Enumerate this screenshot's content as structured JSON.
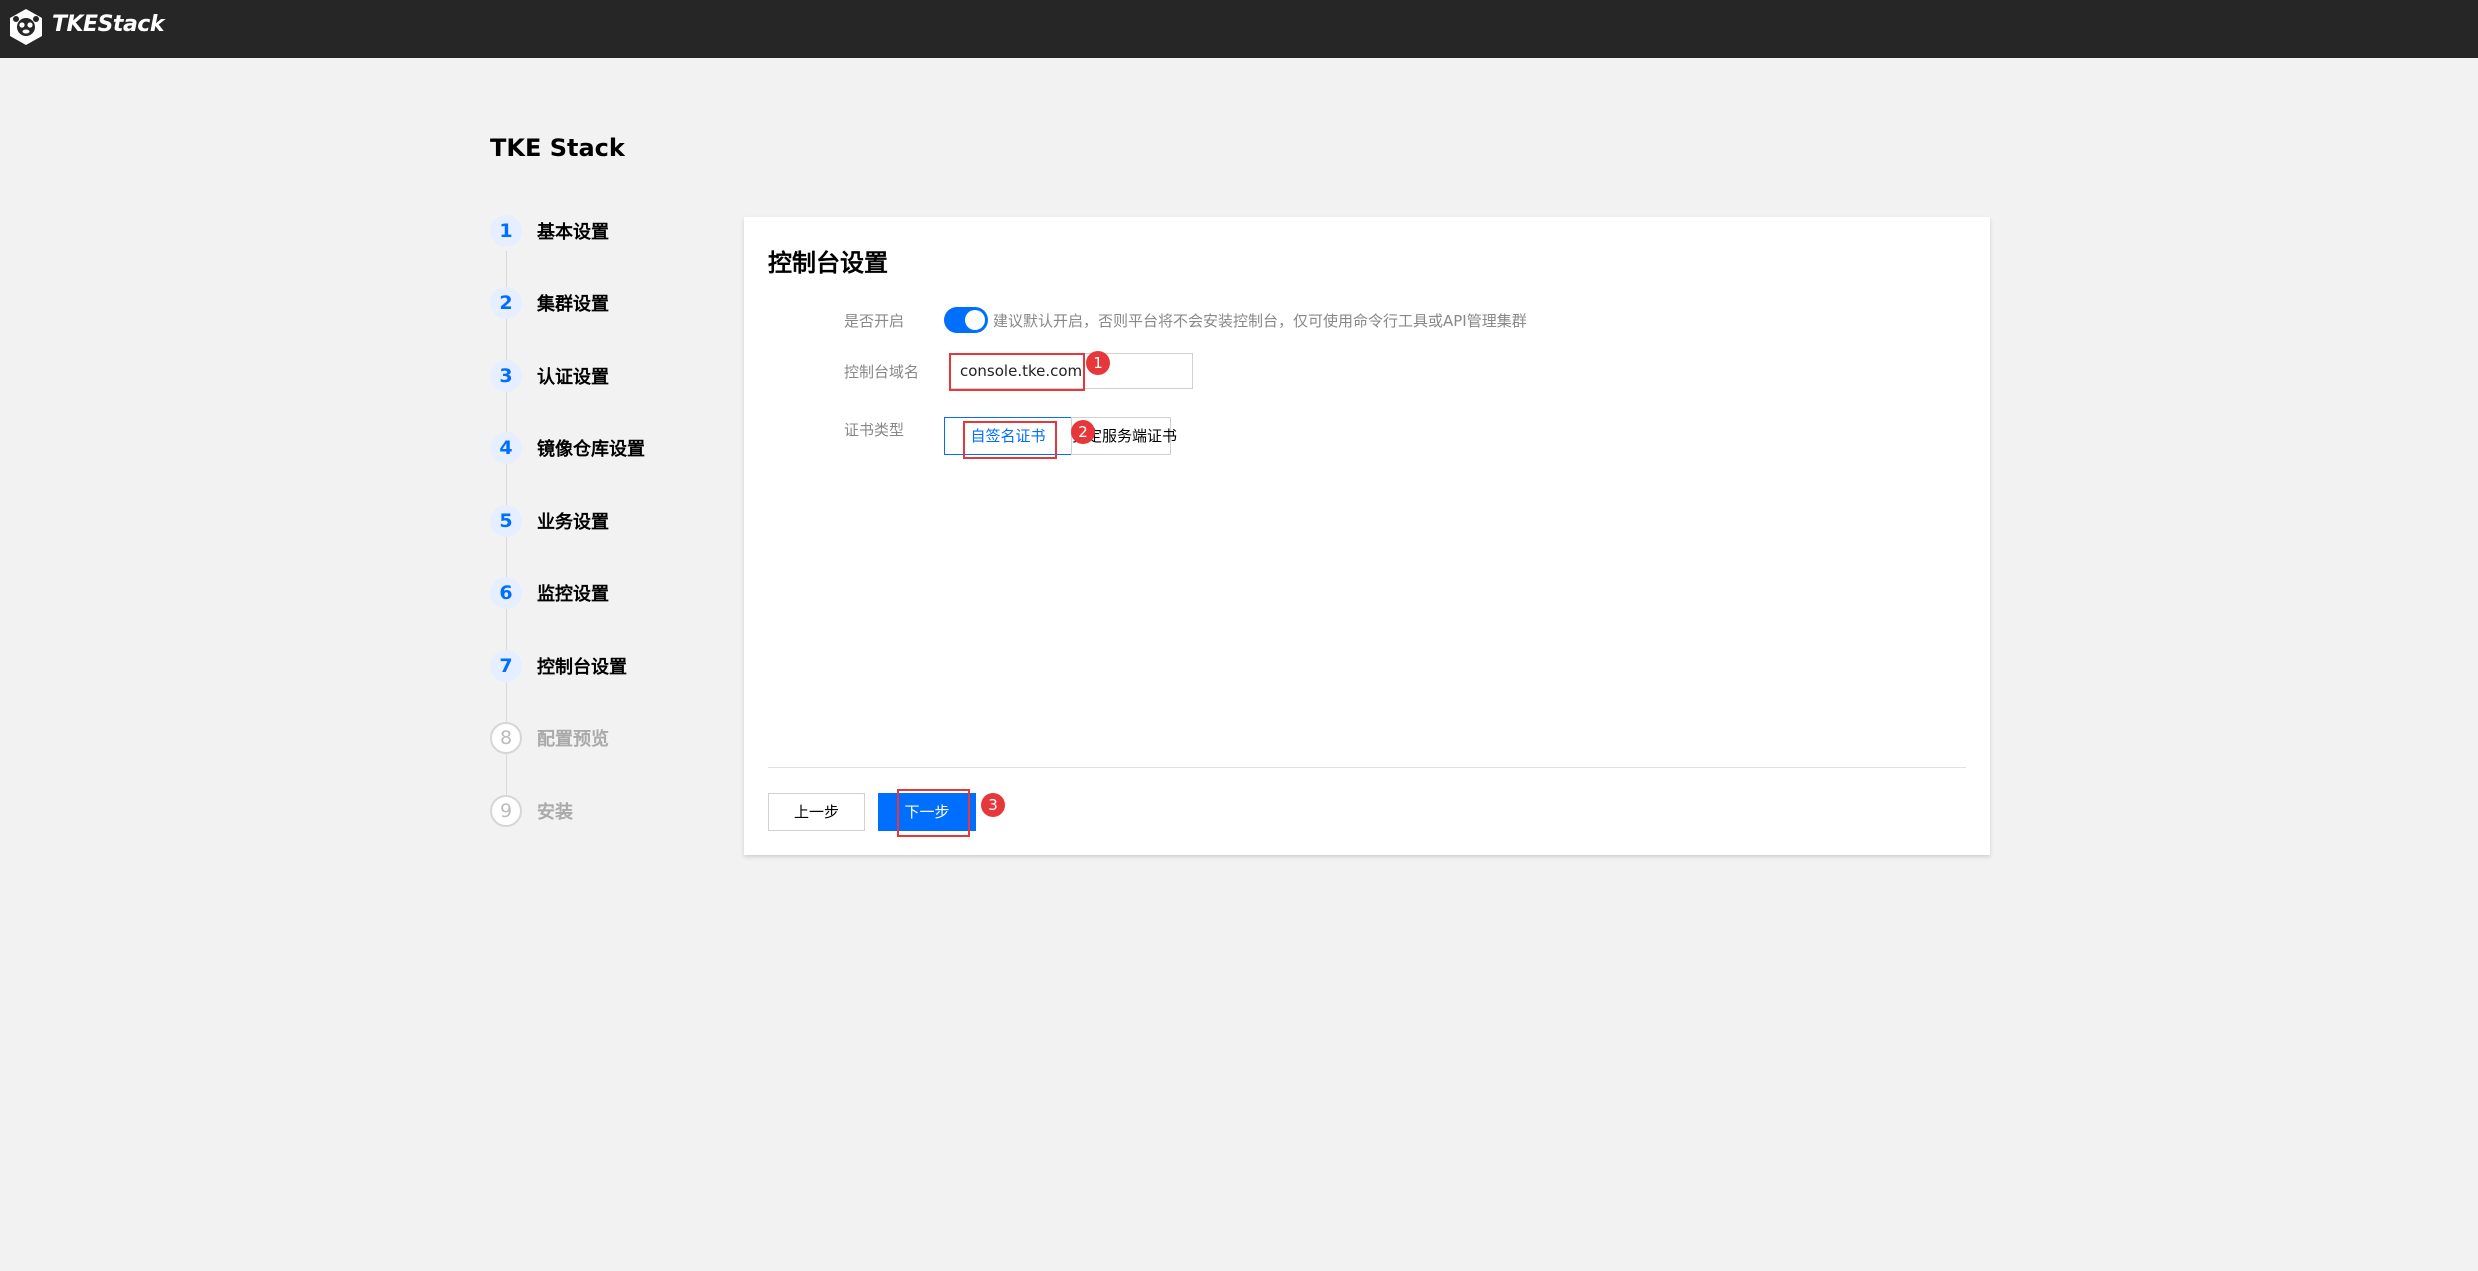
{
  "app": {
    "name": "TKEStack"
  },
  "page": {
    "title": "TKE Stack"
  },
  "steps": [
    {
      "num": "1",
      "label": "基本设置",
      "state": "done"
    },
    {
      "num": "2",
      "label": "集群设置",
      "state": "done"
    },
    {
      "num": "3",
      "label": "认证设置",
      "state": "done"
    },
    {
      "num": "4",
      "label": "镜像仓库设置",
      "state": "done"
    },
    {
      "num": "5",
      "label": "业务设置",
      "state": "done"
    },
    {
      "num": "6",
      "label": "监控设置",
      "state": "done"
    },
    {
      "num": "7",
      "label": "控制台设置",
      "state": "done"
    },
    {
      "num": "8",
      "label": "配置预览",
      "state": "todo"
    },
    {
      "num": "9",
      "label": "安装",
      "state": "todo"
    }
  ],
  "form": {
    "title": "控制台设置",
    "enable_label": "是否开启",
    "enable_hint": "建议默认开启，否则平台将不会安装控制台，仅可使用命令行工具或API管理集群",
    "enable_on": true,
    "domain_label": "控制台域名",
    "domain_value": "console.tke.com",
    "cert_label": "证书类型",
    "cert_options": [
      "自签名证书",
      "指定服务端证书"
    ],
    "cert_selected": "自签名证书"
  },
  "buttons": {
    "prev": "上一步",
    "next": "下一步"
  },
  "annotations": [
    "1",
    "2",
    "3"
  ],
  "colors": {
    "accent": "#006eff",
    "topbar": "#262626",
    "annotation": "#e6383b"
  }
}
